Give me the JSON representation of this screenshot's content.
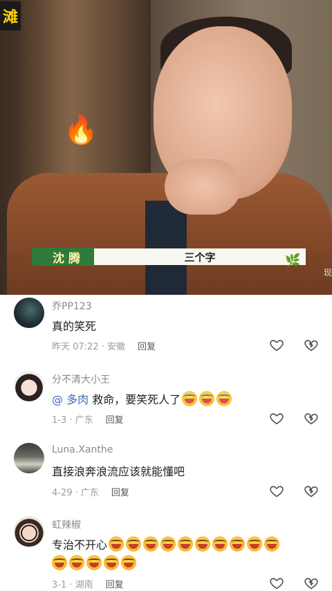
{
  "video": {
    "logo_char": "滩",
    "subtitle_name": "沈腾",
    "subtitle_text": "三个字",
    "side_tag": "现"
  },
  "comments": [
    {
      "username": "乔PP123",
      "text": "真的笑死",
      "time": "昨天 07:22 · 安徽",
      "reply_label": "回复",
      "avatar_icon": "dark-figure-avatar"
    },
    {
      "username": "分不清大小王",
      "mention": "@ 多肉",
      "text": " 救命，要笑死人了",
      "emoji_count": 3,
      "emoji_name": "laugh-cry-emoji",
      "time": "1-3 · 广东",
      "reply_label": "回复",
      "avatar_icon": "girl-avatar"
    },
    {
      "username": "Luna.Xanthe",
      "text": "直接浪奔浪流应该就能懂吧",
      "time": "4-29 · 广东",
      "reply_label": "回复",
      "avatar_icon": "car-night-avatar"
    },
    {
      "username": "虹辣椒",
      "text": "专治不开心",
      "emoji_count": 15,
      "emoji_name": "big-laugh-emoji",
      "time": "3-1 · 湖南",
      "reply_label": "回复",
      "avatar_icon": "sunglasses-girl-avatar"
    }
  ]
}
